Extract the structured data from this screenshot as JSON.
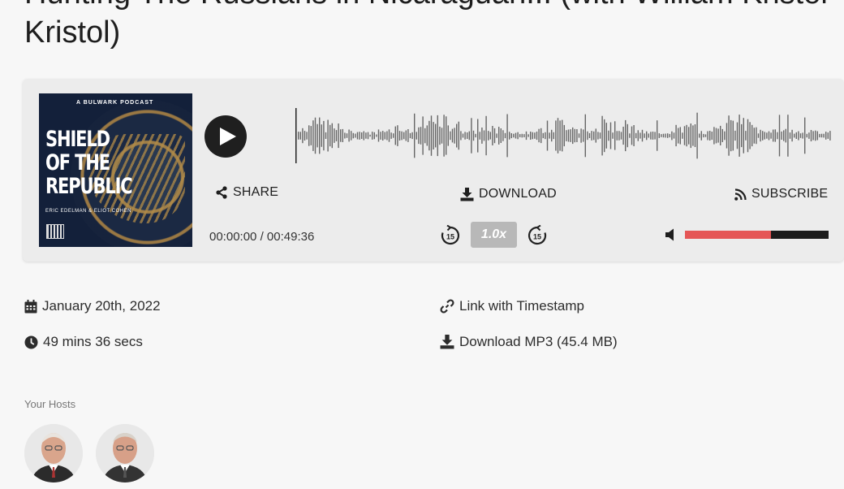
{
  "page": {
    "title_line1": "Hunting The Russians in Nicaraguan... (with William Kristol",
    "title_line2": "Kristol)"
  },
  "player": {
    "cover": {
      "brand": "A BULWARK PODCAST",
      "title_lines": [
        "SHIELD",
        "OF THE",
        "REPUBLIC"
      ],
      "authors": "ERIC EDELMAN & ELIOT COHEN"
    },
    "share_label": "SHARE",
    "download_label": "DOWNLOAD",
    "subscribe_label": "SUBSCRIBE",
    "current_time": "00:00:00",
    "separator": "/",
    "total_time": "00:49:36",
    "speed_label": "1.0x",
    "skip_seconds": "15",
    "volume_level": 0.6,
    "colors": {
      "accent": "#e55656",
      "track": "#1c1c1c",
      "wave": "#666666"
    }
  },
  "meta": {
    "date": "January 20th, 2022",
    "duration": "49 mins 36 secs",
    "link_label": "Link with Timestamp",
    "mp3_label": "Download MP3 (45.4 MB)"
  },
  "hosts": {
    "label": "Your Hosts"
  }
}
